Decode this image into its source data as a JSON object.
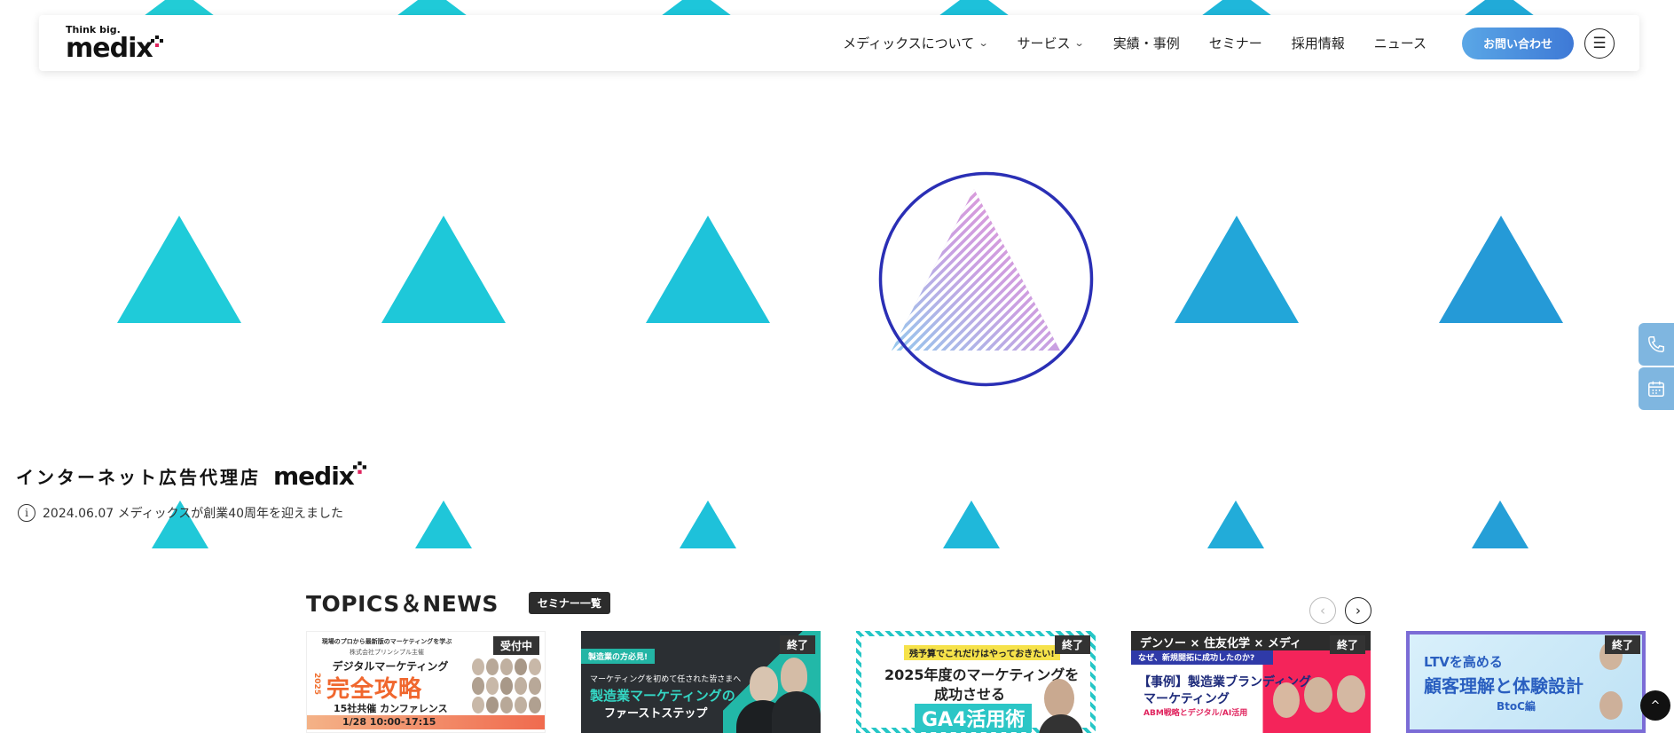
{
  "header": {
    "logo_tag": "Think big.",
    "logo_word": "medix",
    "nav": [
      {
        "label": "メディックスについて",
        "has_dropdown": true
      },
      {
        "label": "サービス",
        "has_dropdown": true
      },
      {
        "label": "実績・事例",
        "has_dropdown": false
      },
      {
        "label": "セミナー",
        "has_dropdown": false
      },
      {
        "label": "採用情報",
        "has_dropdown": false
      },
      {
        "label": "ニュース",
        "has_dropdown": false
      }
    ],
    "contact_label": "お問い合わせ",
    "menu_icon": "hamburger-icon"
  },
  "hero": {
    "tagline": "インターネット広告代理店",
    "tagline_logo": "medix",
    "news": "2024.06.07 メディックスが創業40周年を迎えました",
    "colors": {
      "cyan": "#1ec8d8",
      "blue": "#2a9bd6",
      "ring": "#2a2fb5",
      "pink": "#e88ad0"
    }
  },
  "topics": {
    "title": "TOPICS＆NEWS",
    "seminar_list_label": "セミナー一覧",
    "cards": [
      {
        "status": "受付中",
        "headline": "デジタルマーケティング 完全攻略",
        "sub": "15社共催 カンファレンス",
        "date": "1/28 10:00-17:15",
        "top": "現場のプロから最新版のマーケティングを学ぶ",
        "org": "株式会社プリンシプル主催",
        "year": "2025"
      },
      {
        "status": "終了",
        "headline": "製造業マーケティングの",
        "sub": "ファーストステップ",
        "top": "製造業の方必見!",
        "lead": "マーケティングを初めて任された皆さまへ"
      },
      {
        "status": "終了",
        "headline": "2025年度のマーケティングを",
        "sub": "成功させる",
        "big": "GA4活用術",
        "top": "残予算でこれだけはやっておきたい!"
      },
      {
        "status": "終了",
        "headline": "【事例】製造業ブランディング・",
        "sub": "マーケティング",
        "top": "デンソー × 住友化学 × メディ",
        "lead": "なぜ、新規開拓に成功したのか?",
        "note": "ABM戦略とデジタル/AI活用"
      },
      {
        "status": "終了",
        "headline": "LTVを高める",
        "sub": "顧客理解と体験設計",
        "note": "BtoC編"
      }
    ]
  }
}
